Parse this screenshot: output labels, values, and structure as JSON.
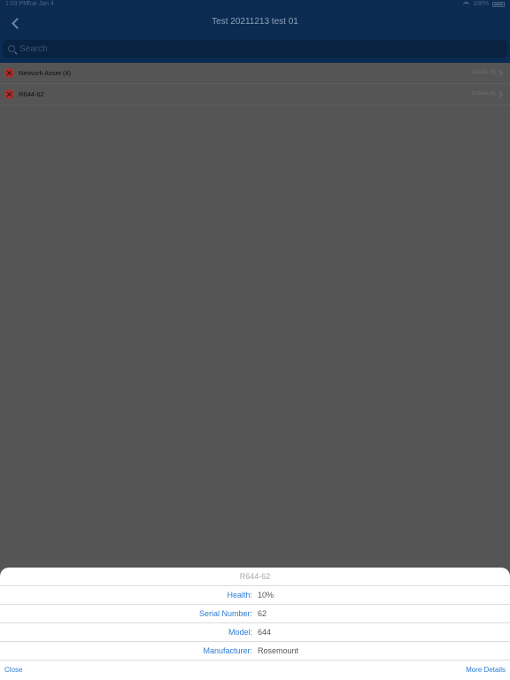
{
  "status_bar": {
    "time": "1:03 PM",
    "date": "Tue Jan 4",
    "battery": "100%"
  },
  "nav": {
    "title": "Test 20211213 test 01",
    "back_icon": "chevron-left-icon"
  },
  "search": {
    "placeholder": "Search"
  },
  "list": {
    "items": [
      {
        "label": "Network Asset (4)",
        "detail": "Details (4)",
        "status_icon": "error-x-icon"
      },
      {
        "label": "R644-62",
        "detail": "Details (4)",
        "status_icon": "error-x-icon"
      }
    ]
  },
  "sheet": {
    "title": "R644-62",
    "rows": [
      {
        "label": "Health:",
        "value": "10%"
      },
      {
        "label": "Serial Number:",
        "value": "62"
      },
      {
        "label": "Model:",
        "value": "644"
      },
      {
        "label": "Manufacturer:",
        "value": "Rosemount"
      }
    ],
    "close_label": "Close",
    "more_label": "More Details"
  },
  "colors": {
    "header_bg": "#0c2b52",
    "dim_overlay": "#555555",
    "accent_blue": "#2d7cd1",
    "error_red": "#a8312d"
  }
}
